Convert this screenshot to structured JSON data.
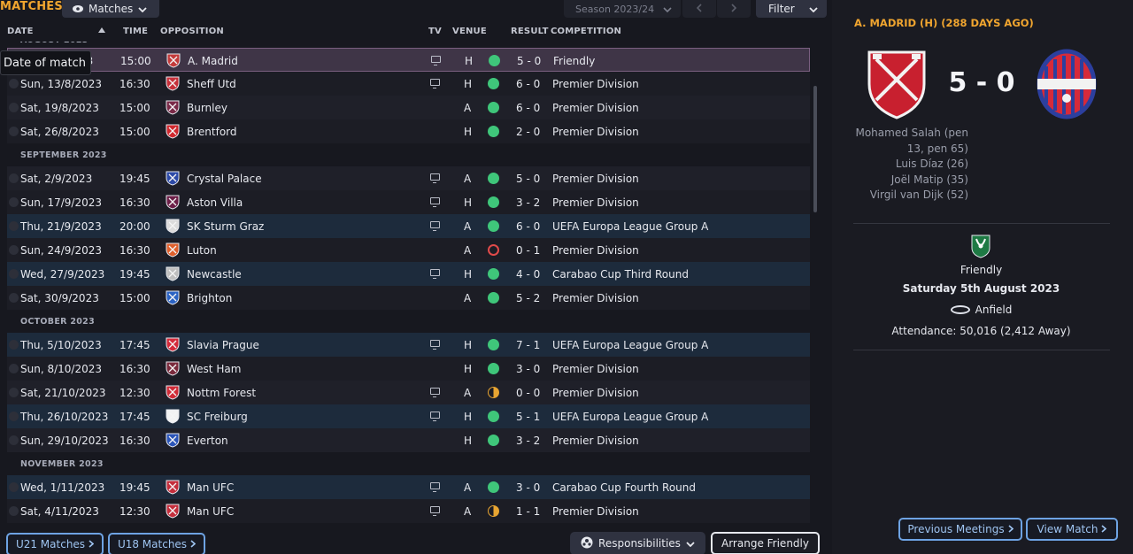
{
  "header": {
    "title": "MATCHES",
    "view_label": "Matches",
    "season_label": "Season 2023/24",
    "filter_label": "Filter",
    "prev_icon": "chevron-left-icon",
    "next_icon": "chevron-right-icon"
  },
  "columns": {
    "date": "DATE",
    "time": "TIME",
    "opposition": "OPPOSITION",
    "tv": "TV",
    "venue": "VENUE",
    "result": "RESULT",
    "competition": "COMPETITION"
  },
  "tooltip": "Date of match",
  "months": {
    "aug": "AUGUST 2023",
    "sep": "SEPTEMBER 2023",
    "oct": "OCTOBER 2023",
    "nov": "NOVEMBER 2023"
  },
  "matches": [
    {
      "date": "Sat, 5/8/2023",
      "time": "15:00",
      "opp": "A. Madrid",
      "tv": true,
      "venue": "H",
      "outcome": "win",
      "result": "5 - 0",
      "comp": "Friendly",
      "crest": "#c43b3b"
    },
    {
      "date": "Sun, 13/8/2023",
      "time": "16:30",
      "opp": "Sheff Utd",
      "tv": true,
      "venue": "H",
      "outcome": "win",
      "result": "6 - 0",
      "comp": "Premier Division",
      "crest": "#c7303a"
    },
    {
      "date": "Sat, 19/8/2023",
      "time": "15:00",
      "opp": "Burnley",
      "tv": false,
      "venue": "A",
      "outcome": "win",
      "result": "6 - 0",
      "comp": "Premier Division",
      "crest": "#7a2a48"
    },
    {
      "date": "Sat, 26/8/2023",
      "time": "15:00",
      "opp": "Brentford",
      "tv": false,
      "venue": "H",
      "outcome": "win",
      "result": "2 - 0",
      "comp": "Premier Division",
      "crest": "#d0282e"
    },
    {
      "date": "Sat, 2/9/2023",
      "time": "19:45",
      "opp": "Crystal Palace",
      "tv": true,
      "venue": "A",
      "outcome": "win",
      "result": "5 - 0",
      "comp": "Premier Division",
      "crest": "#2d4aa8"
    },
    {
      "date": "Sun, 17/9/2023",
      "time": "16:30",
      "opp": "Aston Villa",
      "tv": true,
      "venue": "H",
      "outcome": "win",
      "result": "3 - 2",
      "comp": "Premier Division",
      "crest": "#6d1f48"
    },
    {
      "date": "Thu, 21/9/2023",
      "time": "20:00",
      "opp": "SK Sturm Graz",
      "tv": true,
      "venue": "A",
      "outcome": "win",
      "result": "6 - 0",
      "comp": "UEFA Europa League Group A",
      "crest": "#dcdcdc"
    },
    {
      "date": "Sun, 24/9/2023",
      "time": "16:30",
      "opp": "Luton",
      "tv": false,
      "venue": "A",
      "outcome": "loss",
      "result": "0 - 1",
      "comp": "Premier Division",
      "crest": "#e0602c"
    },
    {
      "date": "Wed, 27/9/2023",
      "time": "19:45",
      "opp": "Newcastle",
      "tv": true,
      "venue": "H",
      "outcome": "win",
      "result": "4 - 0",
      "comp": "Carabao Cup Third Round",
      "crest": "#bfbfbf"
    },
    {
      "date": "Sat, 30/9/2023",
      "time": "15:00",
      "opp": "Brighton",
      "tv": false,
      "venue": "A",
      "outcome": "win",
      "result": "5 - 2",
      "comp": "Premier Division",
      "crest": "#2c63c4"
    },
    {
      "date": "Thu, 5/10/2023",
      "time": "17:45",
      "opp": "Slavia Prague",
      "tv": true,
      "venue": "H",
      "outcome": "win",
      "result": "7 - 1",
      "comp": "UEFA Europa League Group A",
      "crest": "#d42a3a"
    },
    {
      "date": "Sun, 8/10/2023",
      "time": "16:30",
      "opp": "West Ham",
      "tv": false,
      "venue": "H",
      "outcome": "win",
      "result": "3 - 0",
      "comp": "Premier Division",
      "crest": "#7a2a3c"
    },
    {
      "date": "Sat, 21/10/2023",
      "time": "12:30",
      "opp": "Nottm Forest",
      "tv": true,
      "venue": "A",
      "outcome": "draw",
      "result": "0 - 0",
      "comp": "Premier Division",
      "crest": "#d02c38"
    },
    {
      "date": "Thu, 26/10/2023",
      "time": "17:45",
      "opp": "SC Freiburg",
      "tv": true,
      "venue": "H",
      "outcome": "win",
      "result": "5 - 1",
      "comp": "UEFA Europa League Group A",
      "crest": "#f2f2f2"
    },
    {
      "date": "Sun, 29/10/2023",
      "time": "16:30",
      "opp": "Everton",
      "tv": false,
      "venue": "H",
      "outcome": "win",
      "result": "3 - 2",
      "comp": "Premier Division",
      "crest": "#2b55b8"
    },
    {
      "date": "Wed, 1/11/2023",
      "time": "19:45",
      "opp": "Man UFC",
      "tv": true,
      "venue": "A",
      "outcome": "win",
      "result": "3 - 0",
      "comp": "Carabao Cup Fourth Round",
      "crest": "#c42e3c"
    },
    {
      "date": "Sat, 4/11/2023",
      "time": "12:30",
      "opp": "Man UFC",
      "tv": true,
      "venue": "A",
      "outcome": "draw",
      "result": "1 - 1",
      "comp": "Premier Division",
      "crest": "#c42e3c"
    }
  ],
  "buttons": {
    "u21": "U21 Matches",
    "u18": "U18 Matches",
    "responsibilities": "Responsibilities",
    "arrange": "Arrange Friendly"
  },
  "panel": {
    "title": "A. MADRID (H) (288 DAYS AGO)",
    "score": "5 - 0",
    "scorers": [
      "Mohamed Salah (pen",
      "13, pen 65)",
      "Luis Díaz (26)",
      "Joël Matip (35)",
      "Virgil van Dijk (52)"
    ],
    "competition": "Friendly",
    "date": "Saturday 5th August 2023",
    "stadium": "Anfield",
    "attendance": "Attendance: 50,016 (2,412 Away)",
    "prev_meetings": "Previous Meetings",
    "view_match": "View Match",
    "home_color": "#c8202f",
    "away_color": "#2c3f9e"
  }
}
